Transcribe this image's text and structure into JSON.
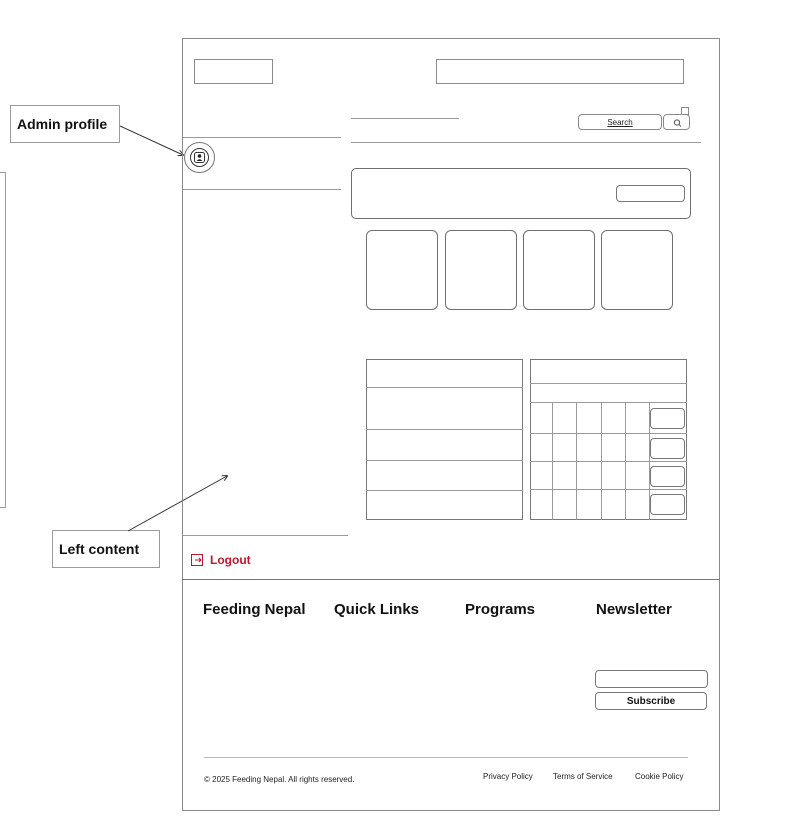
{
  "annotations": {
    "admin_profile": "Admin profile",
    "left_content": "Left content"
  },
  "search": {
    "placeholder": "Search",
    "icon": "search-icon"
  },
  "sidebar": {
    "avatar_icon": "user-icon",
    "logout_label": "Logout",
    "logout_icon": "logout-icon"
  },
  "footer": {
    "brand": "Feeding Nepal",
    "quick_links": "Quick Links",
    "programs": "Programs",
    "newsletter": "Newsletter",
    "subscribe_label": "Subscribe",
    "copyright": "© 2025 Feeding Nepal. All rights reserved.",
    "links": [
      "Privacy Policy",
      "Terms of Service",
      "Cookie Policy"
    ]
  },
  "colors": {
    "logout_red": "#c0152a",
    "border": "#8a8a8a"
  }
}
